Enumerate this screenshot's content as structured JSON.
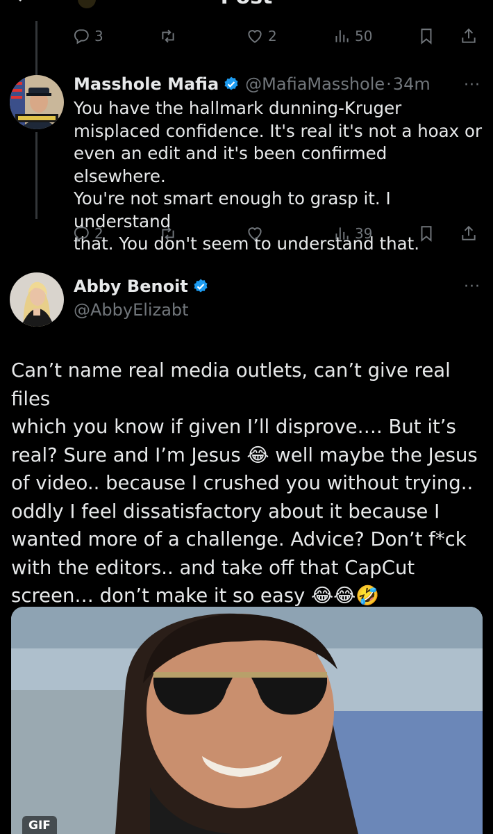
{
  "header": {
    "title": "Post"
  },
  "top_tweet_actions": {
    "replies": "3",
    "likes": "2",
    "views": "50"
  },
  "reply_tweet": {
    "name": "Masshole Mafia",
    "handle": "@MafiaMasshole",
    "separator": "·",
    "time": "34m",
    "text": "You have the hallmark dunning-Kruger\nmisplaced confidence.  It's real it's not a hoax or\neven an edit and it's been confirmed elsewhere.\nYou're not smart enough to grasp it. I understand\nthat. You don't seem to understand that.",
    "actions": {
      "replies": "2",
      "views": "39"
    }
  },
  "main_tweet": {
    "name": "Abby Benoit",
    "handle": "@AbbyElizabt",
    "text": "Can’t name real media outlets, can’t give real files\nwhich you know if given I’ll disprove…. But it’s\nreal? Sure and I’m Jesus 😂 well maybe the Jesus\nof video.. because I crushed you without trying..\noddly I feel dissatisfactory about it because I\nwanted more of a challenge. Advice? Don’t  f*ck\nwith the editors.. and take off that CapCut\nscreen… don’t make it so easy 😂😂🤣",
    "media_label": "GIF"
  },
  "more_label": "···",
  "colors": {
    "background": "#000000",
    "text": "#e7e9ea",
    "muted": "#71767b",
    "verified": "#1d9bf0",
    "thread_line": "#333639"
  },
  "icons": [
    "back-arrow-icon",
    "reply-icon",
    "repost-icon",
    "like-icon",
    "views-icon",
    "bookmark-icon",
    "share-icon",
    "verified-badge-icon",
    "more-options-icon"
  ]
}
